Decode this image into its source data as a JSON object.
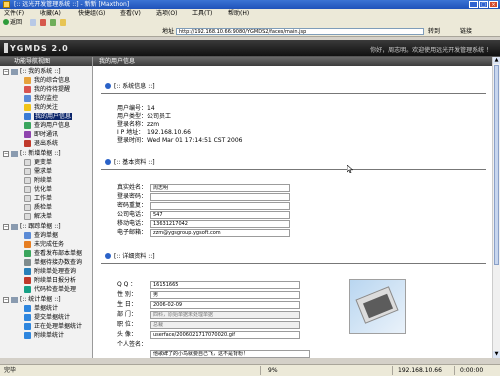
{
  "window": {
    "title": "[:: 远光开发管理系统 ::] - 新新 [Maxthon]"
  },
  "menu": [
    "文件(F)",
    "收藏(A)",
    "快捷组(G)",
    "查看(V)",
    "选项(O)",
    "工具(T)",
    "帮助(H)"
  ],
  "toolbar": {
    "back": "返回"
  },
  "address": {
    "label": "地址",
    "url": "http://192.168.10.66:9080/YGMDS2/faces/main.jsp",
    "go": "转到",
    "links": "链接"
  },
  "app": {
    "logo": "YGMDS 2.0",
    "welcome": "你好，周志明。欢迎使用远光开发管理系统 ！"
  },
  "sidebar": {
    "header": "功能导航视图",
    "groups": [
      {
        "label": "[:: 我的系统 ::]",
        "items": [
          "我的综合信息",
          "我的待待提醒",
          "我的监控",
          "我的关注",
          "我的用户信息",
          "查询用户信息",
          "即时通讯",
          "退出系统"
        ]
      },
      {
        "label": "[:: 新增单据 ::]",
        "items": [
          "更变单",
          "需求单",
          "附续单",
          "优化单",
          "工作单",
          "质检单",
          "解决单"
        ]
      },
      {
        "label": "[:: 跟踪单据 ::]",
        "items": [
          "查询单据",
          "未完成任务",
          "查看发布部本单据",
          "单据待接办数查询",
          "附续单处理查询",
          "附续单日报分析",
          "代码检查单处理"
        ]
      },
      {
        "label": "[:: 统计单据 ::]",
        "items": [
          "单据统计",
          "提交单据统计",
          "正在处理单据统计",
          "附续单统计"
        ]
      }
    ],
    "active": "我的用户信息"
  },
  "content": {
    "header": "我的用户信息",
    "system": {
      "title": "[:: 系统信息 ::]",
      "fields": [
        {
          "k": "用户编号：",
          "v": "14"
        },
        {
          "k": "用户类型：",
          "v": "公司员工"
        },
        {
          "k": "登录名称：",
          "v": "zzm"
        },
        {
          "k": "I P 地址：",
          "v": "192.168.10.66"
        },
        {
          "k": "登录时间：",
          "v": "Wed Mar 01 17:14:51 CST 2006"
        }
      ]
    },
    "basic": {
      "title": "[:: 基本资料 ::]",
      "fields": [
        {
          "k": "真实姓名：",
          "v": "周志明"
        },
        {
          "k": "登录密码：",
          "v": ""
        },
        {
          "k": "密码重复：",
          "v": ""
        },
        {
          "k": "公司电话：",
          "v": "547"
        },
        {
          "k": "移动电话：",
          "v": "13631217042"
        },
        {
          "k": "电子邮箱：",
          "v": "zzm@ygsgroup.ygsoft.com"
        }
      ]
    },
    "detail": {
      "title": "[:: 详细资料 ::]",
      "fields": [
        {
          "k": "Q  Q ：",
          "v": "16151665"
        },
        {
          "k": "性  别：",
          "v": "男"
        },
        {
          "k": "生  日：",
          "v": "2006-02-09"
        },
        {
          "k": "部  门：",
          "v": "四科，原始单据未处理单据"
        },
        {
          "k": "职  位：",
          "v": "总裁"
        },
        {
          "k": "头  像：",
          "v": "userface/2006021717070020.gif"
        },
        {
          "k": "个人签名：",
          "v": "他歌碑了的小鸟就要自己飞，这不是背粉！"
        }
      ]
    }
  },
  "status": {
    "left": "完毕",
    "zoom": "9%",
    "ip": "192.168.10.66",
    "time": "0:00:00"
  },
  "colors": {
    "banner": "#1a1a1a",
    "selection": "#0a246a",
    "title_bar": "#2a5fc8"
  }
}
